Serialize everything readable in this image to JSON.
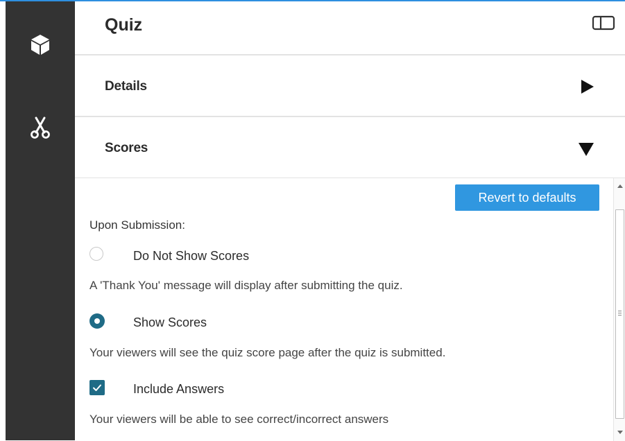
{
  "header": {
    "title": "Quiz"
  },
  "sidebar": {
    "items": [
      {
        "icon": "cube-icon"
      },
      {
        "icon": "scissors-icon"
      }
    ]
  },
  "sections": {
    "details": {
      "label": "Details",
      "state": "collapsed"
    },
    "scores": {
      "label": "Scores",
      "state": "expanded"
    }
  },
  "scores_panel": {
    "revert_button": "Revert to defaults",
    "upon_submission_label": "Upon Submission:",
    "options": [
      {
        "label": "Do Not Show Scores",
        "selected": false,
        "description": "A 'Thank You' message will display after submitting the quiz."
      },
      {
        "label": "Show Scores",
        "selected": true,
        "description": "Your viewers will see the quiz score page after the quiz is submitted."
      }
    ],
    "include_answers": {
      "label": "Include Answers",
      "checked": true,
      "description": "Your viewers will be able to see correct/incorrect answers"
    }
  },
  "colors": {
    "accent_blue": "#3097e0",
    "control_teal": "#1f6b86",
    "rail_dark": "#333333"
  }
}
